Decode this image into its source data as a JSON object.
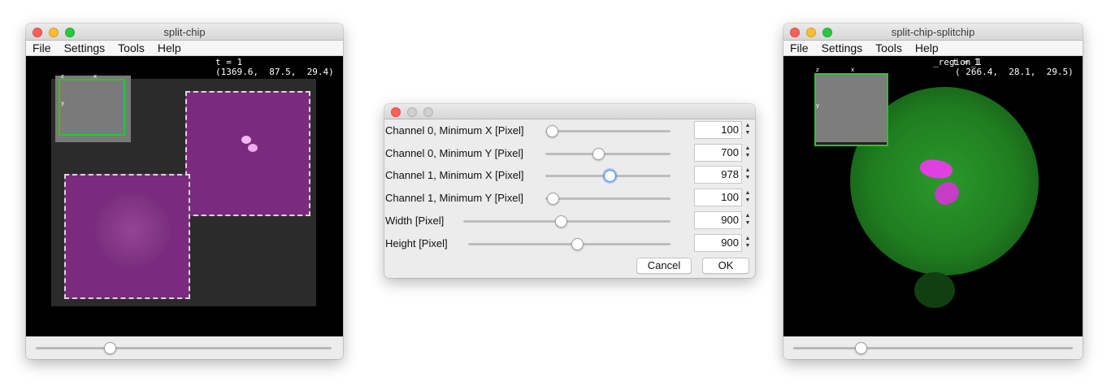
{
  "left_window": {
    "title": "split-chip",
    "menu": [
      "File",
      "Settings",
      "Tools",
      "Help"
    ],
    "overlay_line1": "t = 1",
    "overlay_line2": "(1369.6,  87.5,  29.4)",
    "mini_axes": {
      "z": "z",
      "x": "x",
      "y": "y"
    },
    "slider_fraction": 0.25
  },
  "dialog": {
    "rows": [
      {
        "label": "Channel 0, Minimum X [Pixel]",
        "value": "100",
        "slider_fraction": 0.05
      },
      {
        "label": "Channel 0, Minimum Y [Pixel]",
        "value": "700",
        "slider_fraction": 0.42
      },
      {
        "label": "Channel 1, Minimum X [Pixel]",
        "value": "978",
        "slider_fraction": 0.51
      },
      {
        "label": "Channel 1, Minimum Y [Pixel]",
        "value": "100",
        "slider_fraction": 0.06
      },
      {
        "label": "Width [Pixel]",
        "value": "900",
        "slider_fraction": 0.47
      },
      {
        "label": "Height [Pixel]",
        "value": "900",
        "slider_fraction": 0.54
      }
    ],
    "cancel_label": "Cancel",
    "ok_label": "OK"
  },
  "right_window": {
    "title": "split-chip-splitchip",
    "menu": [
      "File",
      "Settings",
      "Tools",
      "Help"
    ],
    "overlay_line1": "_region_1",
    "overlay_line1b": "t = 1",
    "overlay_line2": "( 266.4,  28.1,  29.5)",
    "mini_axes": {
      "z": "z",
      "x": "x",
      "y": "y"
    },
    "slider_fraction": 0.24
  },
  "colors": {
    "magenta": "#b03cb0",
    "green": "#1f8a1f",
    "box_green": "#2cc52c",
    "focus_blue": "#3b82f6"
  }
}
